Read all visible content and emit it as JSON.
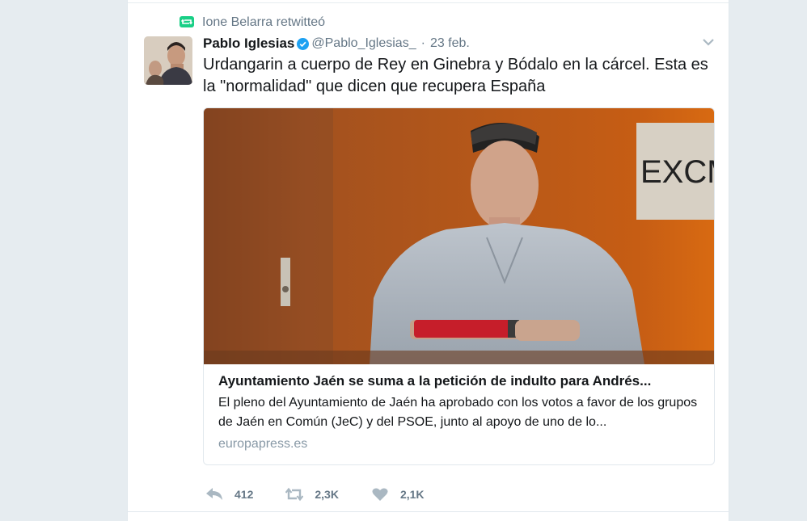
{
  "retweet_context": {
    "text": "Ione Belarra retwitteó",
    "icon": "retweet-icon",
    "color": "#19cf86"
  },
  "tweet": {
    "author_name": "Pablo Iglesias",
    "handle": "@Pablo_Iglesias_",
    "separator": "·",
    "date": "23 feb.",
    "text": "Urdangarin a cuerpo de Rey en Ginebra y Bódalo en la cárcel. Esta es la \"normalidad\" que dicen que recupera España"
  },
  "card": {
    "title": "Ayuntamiento Jaén se suma a la petición de indulto para Andrés...",
    "description": "El pleno del Ayuntamiento de Jaén ha aprobado con los votos a favor de los grupos de Jaén en Común (JeC) y del PSOE, junto al apoyo de uno de lo...",
    "domain": "europapress.es",
    "image_sign_text": "EXCM"
  },
  "actions": {
    "reply": {
      "icon": "reply-icon",
      "count": "412"
    },
    "retweet": {
      "icon": "retweet-icon",
      "count": "2,3K"
    },
    "like": {
      "icon": "heart-icon",
      "count": "2,1K"
    }
  },
  "colors": {
    "verified": "#1da1f2",
    "secondary_text": "#657786",
    "retweet_green": "#19cf86"
  }
}
